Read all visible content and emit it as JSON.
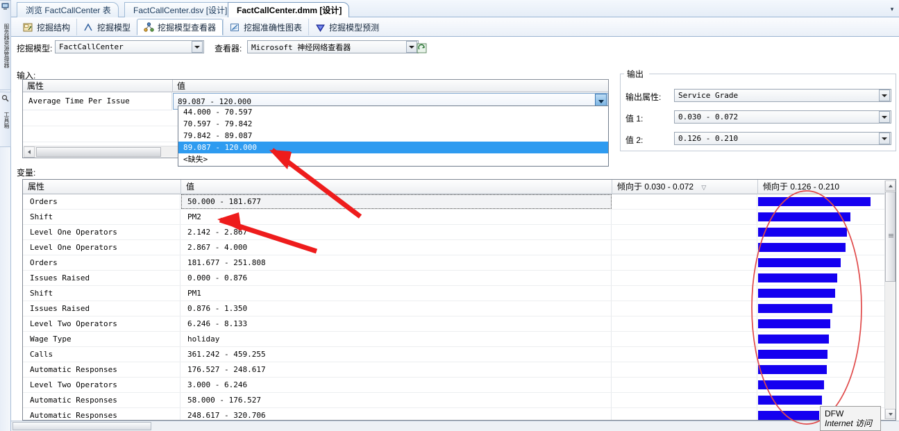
{
  "window": {
    "doc_tabs": [
      {
        "label": "浏览 FactCallCenter 表",
        "active": false
      },
      {
        "label": "FactCallCenter.dsv [设计]",
        "active": false
      },
      {
        "label": "FactCallCenter.dmm [设计]",
        "active": true
      }
    ],
    "tab_overflow_icon": "chevron-down-icon"
  },
  "view_tabs": [
    {
      "label": "挖掘结构",
      "icon": "mining-structure-icon",
      "selected": false
    },
    {
      "label": "挖掘模型",
      "icon": "mining-model-icon",
      "selected": false
    },
    {
      "label": "挖掘模型查看器",
      "icon": "mining-model-viewer-icon",
      "selected": true
    },
    {
      "label": "挖掘准确性图表",
      "icon": "accuracy-chart-icon",
      "selected": false
    },
    {
      "label": "挖掘模型预测",
      "icon": "prediction-icon",
      "selected": false
    }
  ],
  "selector_row": {
    "model_label": "挖掘模型:",
    "model_value": "FactCallCenter",
    "viewer_label": "查看器:",
    "viewer_value": "Microsoft 神经网络查看器",
    "refresh_icon": "refresh-icon"
  },
  "input_section": {
    "legend": "输入:",
    "columns": [
      "属性",
      "值"
    ],
    "row": {
      "attribute": "Average Time Per Issue",
      "value": "89.087 - 120.000"
    },
    "dropdown_open": true,
    "dropdown_options": [
      {
        "label": "44.000 - 70.597",
        "selected": false
      },
      {
        "label": "70.597 - 79.842",
        "selected": false
      },
      {
        "label": "79.842 - 89.087",
        "selected": false
      },
      {
        "label": "89.087 - 120.000",
        "selected": true
      },
      {
        "label": "<缺失>",
        "selected": false
      }
    ]
  },
  "output_section": {
    "legend": "输出",
    "attribute_label": "输出属性:",
    "attribute_value": "Service Grade",
    "value1_label": "值 1:",
    "value1_value": "0.030 - 0.072",
    "value2_label": "值 2:",
    "value2_value": "0.126 - 0.210"
  },
  "variables_section": {
    "legend": "变量:",
    "columns": {
      "attribute": "属性",
      "value": "值",
      "favors1": "倾向于 0.030 - 0.072",
      "favors2": "倾向于 0.126 - 0.210",
      "sort_icon": "sort-descending-icon"
    },
    "rows": [
      {
        "attribute": "Orders",
        "value": "50.000 - 181.677",
        "bar1": 0,
        "bar2": 95,
        "focused": true
      },
      {
        "attribute": "Shift",
        "value": "PM2",
        "bar1": 0,
        "bar2": 78,
        "focused": false
      },
      {
        "attribute": "Level One Operators",
        "value": "2.142 - 2.867",
        "bar1": 0,
        "bar2": 75,
        "focused": false
      },
      {
        "attribute": "Level One Operators",
        "value": "2.867 - 4.000",
        "bar1": 0,
        "bar2": 74,
        "focused": false
      },
      {
        "attribute": "Orders",
        "value": "181.677 - 251.808",
        "bar1": 0,
        "bar2": 70,
        "focused": false
      },
      {
        "attribute": "Issues Raised",
        "value": "0.000 - 0.876",
        "bar1": 0,
        "bar2": 67,
        "focused": false
      },
      {
        "attribute": "Shift",
        "value": "PM1",
        "bar1": 0,
        "bar2": 65,
        "focused": false
      },
      {
        "attribute": "Issues Raised",
        "value": "0.876 - 1.350",
        "bar1": 0,
        "bar2": 63,
        "focused": false
      },
      {
        "attribute": "Level Two Operators",
        "value": "6.246 - 8.133",
        "bar1": 0,
        "bar2": 61,
        "focused": false
      },
      {
        "attribute": "Wage Type",
        "value": "holiday",
        "bar1": 0,
        "bar2": 60,
        "focused": false
      },
      {
        "attribute": "Calls",
        "value": "361.242 - 459.255",
        "bar1": 0,
        "bar2": 59,
        "focused": false
      },
      {
        "attribute": "Automatic Responses",
        "value": "176.527 - 248.617",
        "bar1": 0,
        "bar2": 58,
        "focused": false
      },
      {
        "attribute": "Level Two Operators",
        "value": "3.000 - 6.246",
        "bar1": 0,
        "bar2": 56,
        "focused": false
      },
      {
        "attribute": "Automatic Responses",
        "value": "58.000 - 176.527",
        "bar1": 0,
        "bar2": 54,
        "focused": false
      },
      {
        "attribute": "Automatic Responses",
        "value": "248.617 - 320.706",
        "bar1": 0,
        "bar2": 52,
        "focused": false
      }
    ],
    "bar_color": "#1500f0"
  },
  "left_strip": {
    "tabs": [
      {
        "label": "服务器资源管理器",
        "icon": "server-explorer-icon"
      },
      {
        "label": "工具箱",
        "icon": "toolbox-icon"
      }
    ]
  },
  "tooltip": {
    "line1": "DFW",
    "line2": "Internet 访问"
  },
  "annotations": {
    "ellipse_color": "#e04a4a",
    "arrow_color": "#ee1c1c",
    "arrow_count": 2,
    "ellipse_count": 1
  }
}
